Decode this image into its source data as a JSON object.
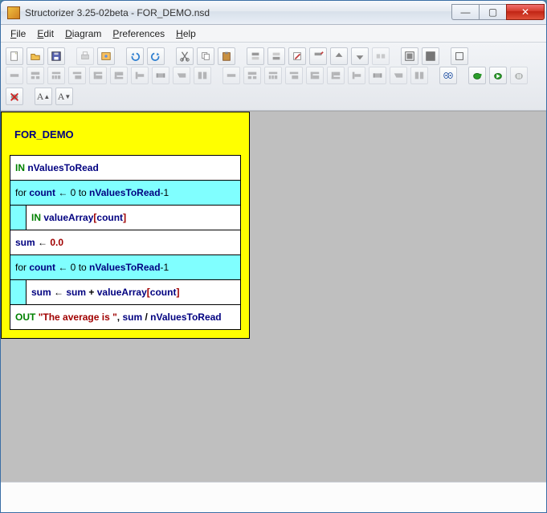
{
  "window": {
    "title": "Structorizer 3.25-02beta - FOR_DEMO.nsd"
  },
  "menubar": {
    "items": [
      {
        "label": "File",
        "accel": "F"
      },
      {
        "label": "Edit",
        "accel": "E"
      },
      {
        "label": "Diagram",
        "accel": "D"
      },
      {
        "label": "Preferences",
        "accel": "P"
      },
      {
        "label": "Help",
        "accel": "H"
      }
    ]
  },
  "toolbar": {
    "row1": [
      "new",
      "open",
      "save",
      "|",
      "print",
      "pdf",
      "|",
      "undo",
      "redo",
      "|",
      "cut",
      "copy",
      "paste",
      "|",
      "add-before",
      "add-after",
      "note",
      "move-up",
      "move-down",
      "delete",
      "|",
      "collapse",
      "expand",
      "|",
      "boxed"
    ],
    "row2": [
      "r-inst",
      "r-alt",
      "r-case",
      "r-for",
      "r-while",
      "r-repeat",
      "r-forever",
      "r-call",
      "r-jump",
      "r-para",
      "|",
      "b-inst",
      "b-alt",
      "b-case",
      "b-for",
      "b-while",
      "b-repeat",
      "b-forever",
      "b-call",
      "b-jump",
      "b-para",
      "|",
      "analyse",
      "turtle",
      "play",
      "pause",
      "stop",
      "font-up",
      "font-down"
    ]
  },
  "diagram": {
    "title": "FOR_DEMO",
    "b1": {
      "kw": "IN",
      "id": "nValuesToRead"
    },
    "for1": {
      "header_pre": "for ",
      "var": "count",
      "mid": " ← 0 to ",
      "limit": "nValuesToRead",
      "tail": "-1",
      "body_kw": "IN",
      "body_id": "valueArray",
      "body_idx_open": "[",
      "body_idx": "count",
      "body_idx_close": "]"
    },
    "b2": {
      "lhs": "sum",
      "arrow": " ← ",
      "rhs": "0.0"
    },
    "for2": {
      "header_pre": "for ",
      "var": "count",
      "mid": " ← 0 to ",
      "limit": "nValuesToRead",
      "tail": "-1",
      "lhs": "sum",
      "arrow": " ← ",
      "r1": "sum",
      "plus": " + ",
      "r2": "valueArray",
      "idx_open": "[",
      "idx": "count",
      "idx_close": "]"
    },
    "out": {
      "kw": "OUT",
      "str": "\"The average is \"",
      "comma": ", ",
      "lhs": "sum",
      "slash": " / ",
      "rhs": "nValuesToRead"
    }
  }
}
